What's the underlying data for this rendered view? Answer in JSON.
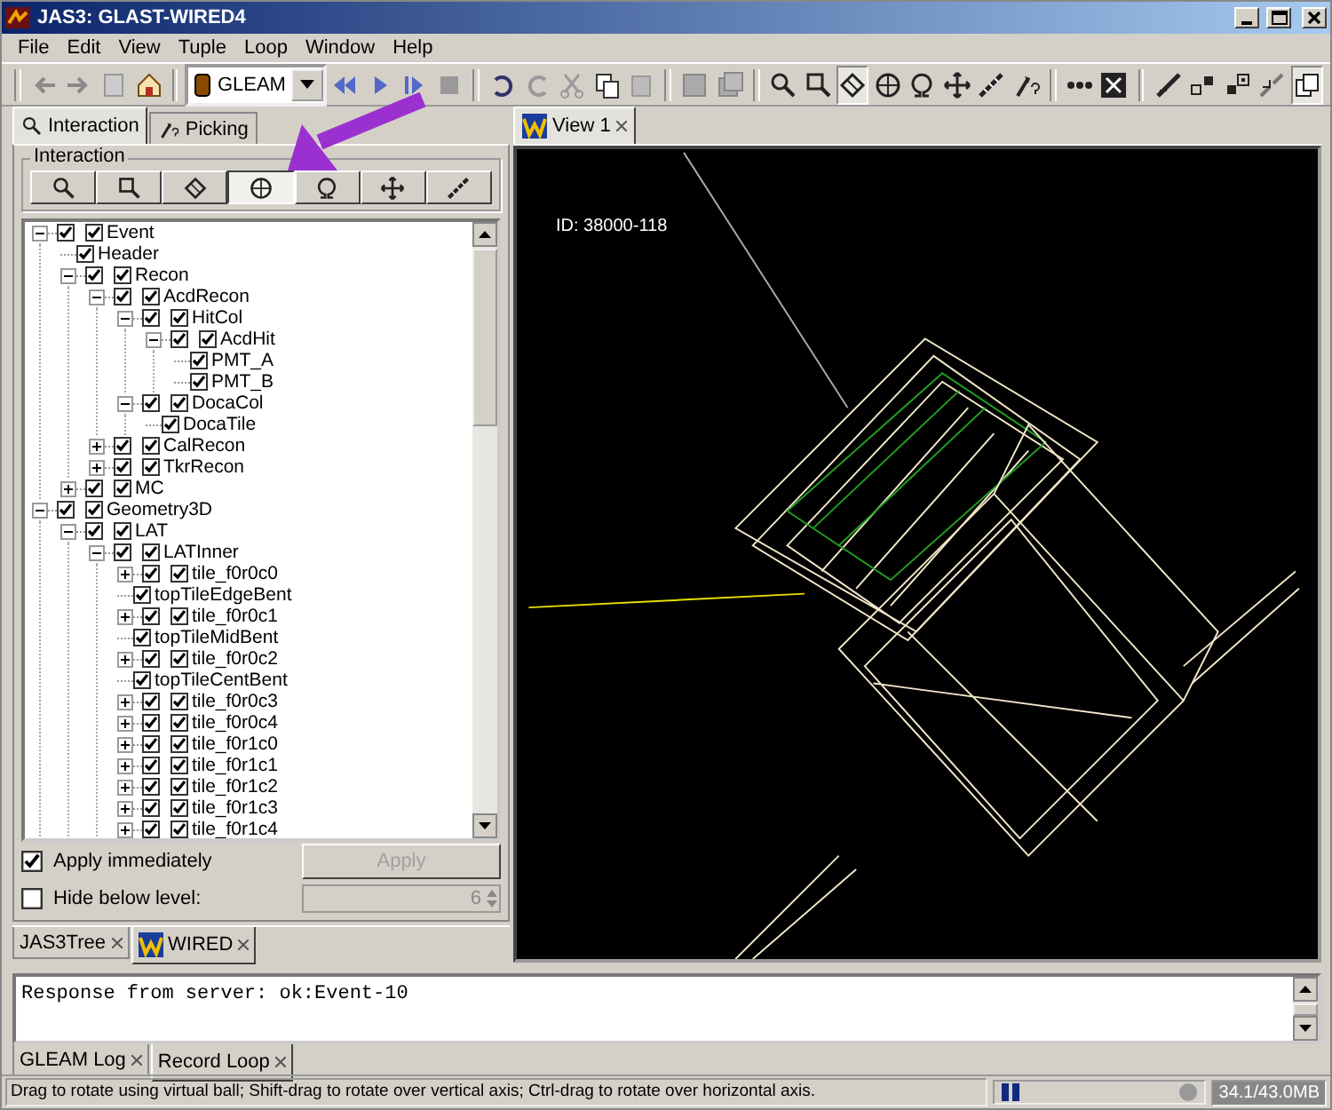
{
  "window": {
    "title": "JAS3: GLAST-WIRED4"
  },
  "menu": [
    "File",
    "Edit",
    "View",
    "Tuple",
    "Loop",
    "Window",
    "Help"
  ],
  "toolbar": {
    "combo": "GLEAM",
    "pressed": [
      false,
      false,
      false,
      false,
      false,
      false,
      false,
      false,
      false,
      false,
      false,
      false,
      false,
      false,
      false,
      false,
      false,
      true,
      false,
      false,
      false,
      false,
      false,
      false,
      false,
      false,
      false,
      false,
      false,
      true
    ]
  },
  "left_tabs": [
    {
      "label": "Interaction",
      "selected": true
    },
    {
      "label": "Picking",
      "selected": false
    }
  ],
  "interaction": {
    "legend": "Interaction",
    "tools": [
      {
        "selected": false
      },
      {
        "selected": false
      },
      {
        "selected": false
      },
      {
        "selected": true
      },
      {
        "selected": false
      },
      {
        "selected": false
      },
      {
        "selected": false
      }
    ]
  },
  "tree": [
    {
      "label": "Event",
      "checked": true,
      "branch_checked": true,
      "expanded": true,
      "children": [
        {
          "label": "Header",
          "checked": true
        },
        {
          "label": "Recon",
          "checked": true,
          "branch_checked": true,
          "expanded": true,
          "children": [
            {
              "label": "AcdRecon",
              "checked": true,
              "branch_checked": true,
              "expanded": true,
              "children": [
                {
                  "label": "HitCol",
                  "checked": true,
                  "branch_checked": true,
                  "expanded": true,
                  "children": [
                    {
                      "label": "AcdHit",
                      "checked": true,
                      "branch_checked": true,
                      "expanded": true,
                      "children": [
                        {
                          "label": "PMT_A",
                          "checked": true
                        },
                        {
                          "label": "PMT_B",
                          "checked": true
                        }
                      ]
                    }
                  ]
                },
                {
                  "label": "DocaCol",
                  "checked": true,
                  "branch_checked": true,
                  "expanded": true,
                  "children": [
                    {
                      "label": "DocaTile",
                      "checked": true
                    }
                  ]
                }
              ]
            },
            {
              "label": "CalRecon",
              "checked": true,
              "branch_checked": true,
              "expanded": false
            },
            {
              "label": "TkrRecon",
              "checked": true,
              "branch_checked": true,
              "expanded": false
            }
          ]
        },
        {
          "label": "MC",
          "checked": true,
          "branch_checked": true,
          "expanded": false
        }
      ]
    },
    {
      "label": "Geometry3D",
      "checked": true,
      "branch_checked": true,
      "expanded": true,
      "children": [
        {
          "label": "LAT",
          "checked": true,
          "branch_checked": true,
          "expanded": true,
          "children": [
            {
              "label": "LATInner",
              "checked": true,
              "branch_checked": true,
              "expanded": true,
              "children": [
                {
                  "label": "tile_f0r0c0",
                  "checked": true,
                  "branch_checked": true,
                  "expanded": false
                },
                {
                  "label": "topTileEdgeBent",
                  "checked": true
                },
                {
                  "label": "tile_f0r0c1",
                  "checked": true,
                  "branch_checked": true,
                  "expanded": false
                },
                {
                  "label": "topTileMidBent",
                  "checked": true
                },
                {
                  "label": "tile_f0r0c2",
                  "checked": true,
                  "branch_checked": true,
                  "expanded": false
                },
                {
                  "label": "topTileCentBent",
                  "checked": true
                },
                {
                  "label": "tile_f0r0c3",
                  "checked": true,
                  "branch_checked": true,
                  "expanded": false
                },
                {
                  "label": "tile_f0r0c4",
                  "checked": true,
                  "branch_checked": true,
                  "expanded": false
                },
                {
                  "label": "tile_f0r1c0",
                  "checked": true,
                  "branch_checked": true,
                  "expanded": false
                },
                {
                  "label": "tile_f0r1c1",
                  "checked": true,
                  "branch_checked": true,
                  "expanded": false
                },
                {
                  "label": "tile_f0r1c2",
                  "checked": true,
                  "branch_checked": true,
                  "expanded": false
                },
                {
                  "label": "tile_f0r1c3",
                  "checked": true,
                  "branch_checked": true,
                  "expanded": false
                },
                {
                  "label": "tile_f0r1c4",
                  "checked": true,
                  "branch_checked": true,
                  "expanded": false
                }
              ]
            }
          ]
        }
      ]
    }
  ],
  "apply_immediately": {
    "label": "Apply immediately",
    "checked": true
  },
  "apply_button": {
    "label": "Apply",
    "disabled": true
  },
  "hide_below": {
    "label": "Hide below level:",
    "checked": false,
    "value": "6"
  },
  "bottom_left_tabs": [
    {
      "label": "JAS3Tree",
      "selected": false
    },
    {
      "label": "WIRED",
      "selected": true
    }
  ],
  "view_tabs": [
    {
      "label": "View 1",
      "selected": true
    }
  ],
  "view": {
    "event_id": "ID: 38000-118"
  },
  "log": {
    "text": "Response from server: ok:Event-10"
  },
  "log_tabs": [
    {
      "label": "GLEAM Log",
      "selected": false
    },
    {
      "label": "Record Loop",
      "selected": true
    }
  ],
  "status_bar": {
    "message": "Drag to rotate using virtual ball; Shift-drag to rotate over vertical axis; Ctrl-drag to rotate over horizontal axis.",
    "memory": "34.1/43.0MB"
  }
}
